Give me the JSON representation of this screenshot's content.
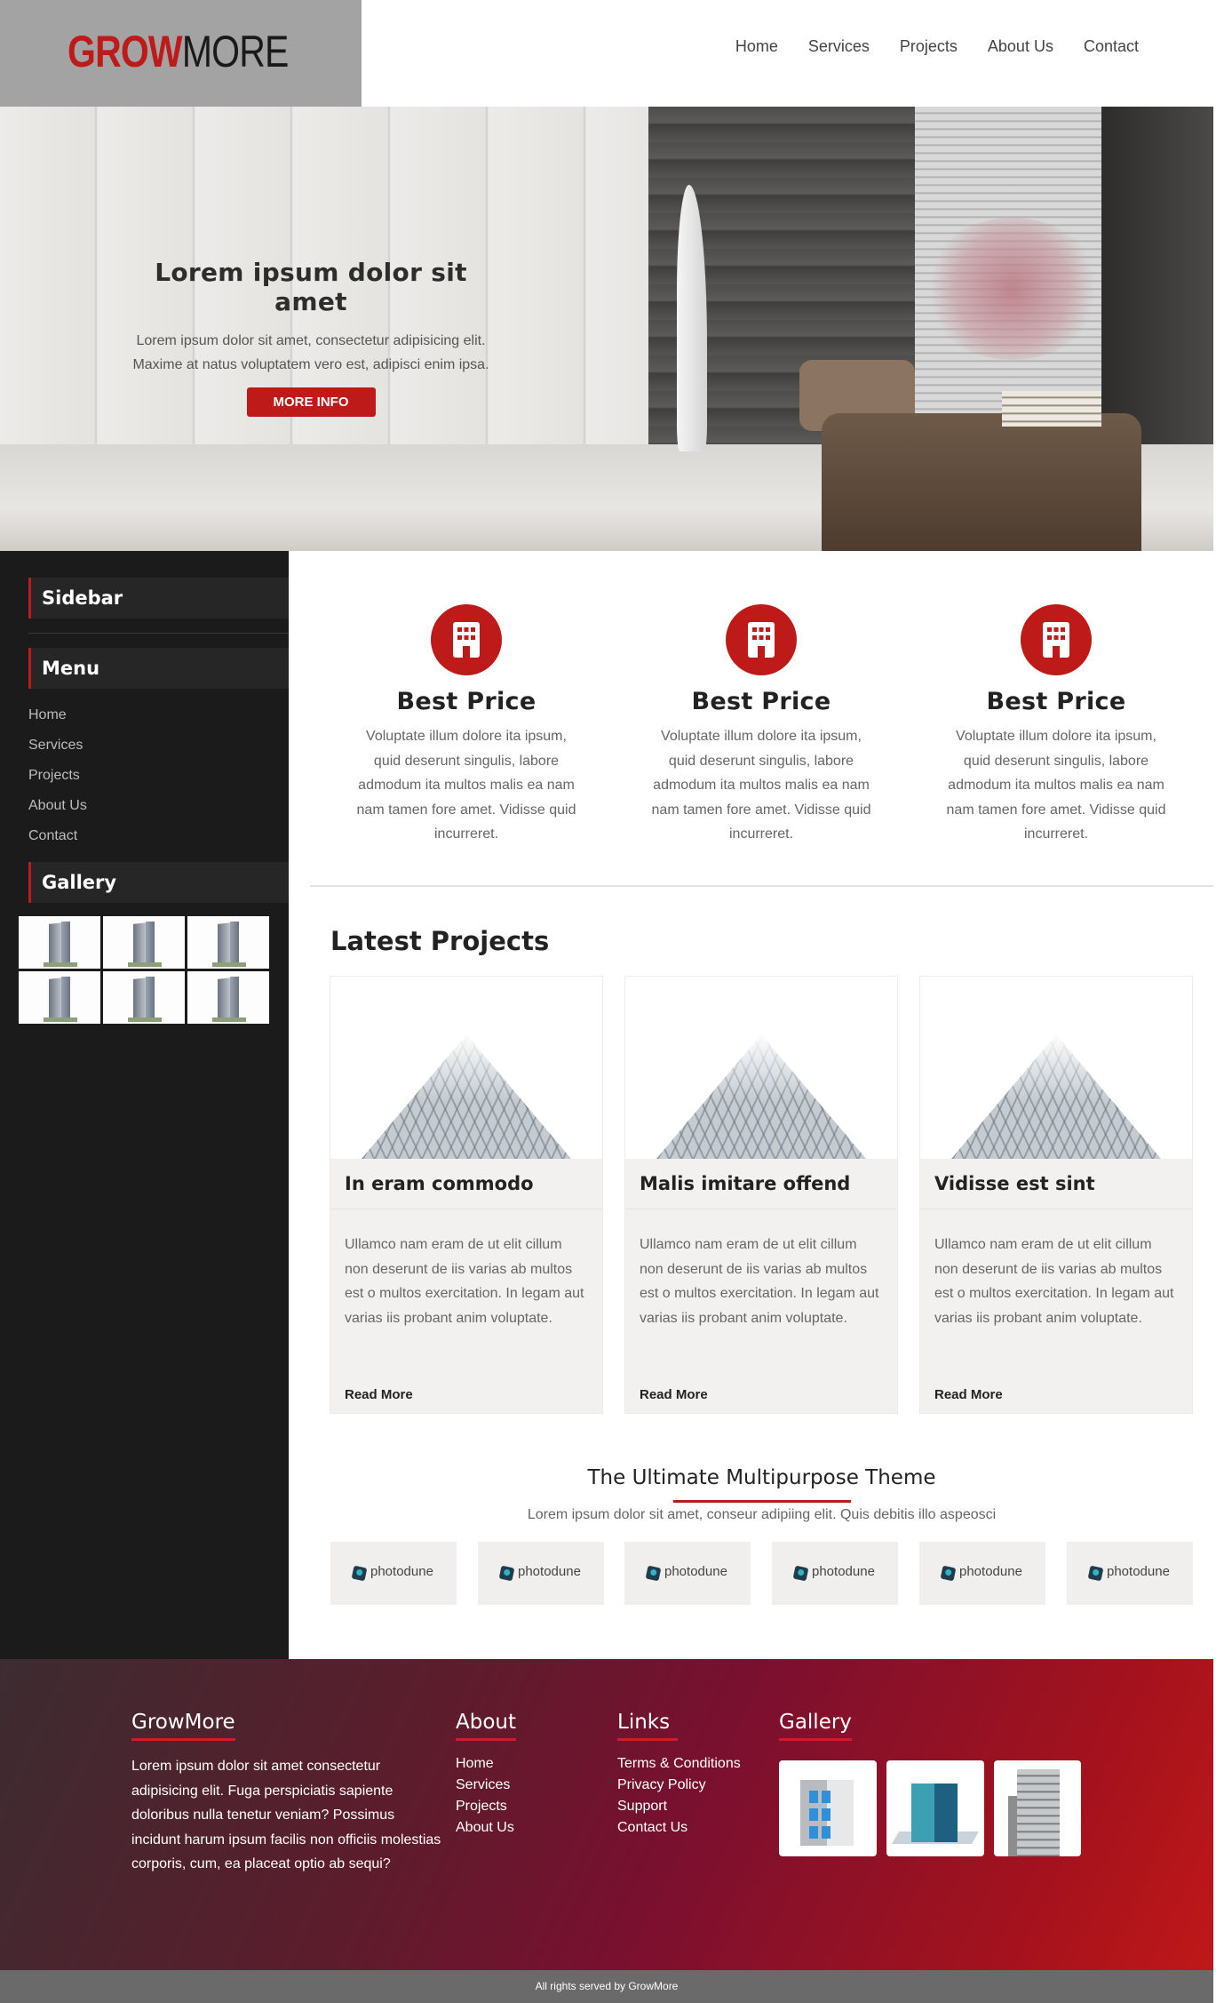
{
  "header": {
    "logo_part1": "GROW",
    "logo_part2": "MORE",
    "nav": [
      "Home",
      "Services",
      "Projects",
      "About Us",
      "Contact"
    ]
  },
  "hero": {
    "title": "Lorem ipsum dolor sit amet",
    "subtitle_line1": "Lorem ipsum dolor sit amet, consectetur adipisicing elit.",
    "subtitle_line2": "Maxime at natus voluptatem vero est, adipisci enim ipsa.",
    "button": "MORE INFO"
  },
  "sidebar": {
    "heading": "Sidebar",
    "menu_heading": "Menu",
    "menu": [
      "Home",
      "Services",
      "Projects",
      "About Us",
      "Contact"
    ],
    "gallery_heading": "Gallery"
  },
  "features": [
    {
      "title": "Best Price",
      "text": "Voluptate illum dolore ita ipsum, quid deserunt singulis, labore admodum ita multos malis ea nam nam tamen fore amet. Vidisse quid incurreret.",
      "icon": "building-icon"
    },
    {
      "title": "Best Price",
      "text": "Voluptate illum dolore ita ipsum, quid deserunt singulis, labore admodum ita multos malis ea nam nam tamen fore amet. Vidisse quid incurreret.",
      "icon": "building-icon"
    },
    {
      "title": "Best Price",
      "text": "Voluptate illum dolore ita ipsum, quid deserunt singulis, labore admodum ita multos malis ea nam nam tamen fore amet. Vidisse quid incurreret.",
      "icon": "building-icon"
    }
  ],
  "projects": {
    "title": "Latest Projects",
    "items": [
      {
        "title": "In eram commodo",
        "text": "Ullamco nam eram de ut elit cillum non deserunt de iis varias ab multos est o multos exercitation. In legam aut varias iis probant anim voluptate.",
        "link": "Read More"
      },
      {
        "title": "Malis imitare offend",
        "text": "Ullamco nam eram de ut elit cillum non deserunt de iis varias ab multos est o multos exercitation. In legam aut varias iis probant anim voluptate.",
        "link": "Read More"
      },
      {
        "title": "Vidisse est sint",
        "text": "Ullamco nam eram de ut elit cillum non deserunt de iis varias ab multos est o multos exercitation. In legam aut varias iis probant anim voluptate.",
        "link": "Read More"
      }
    ]
  },
  "theme": {
    "title": "The Ultimate Multipurpose Theme",
    "subtitle": "Lorem ipsum dolor sit amet, conseur adipiing elit. Quis debitis illo aspeosci",
    "partners": [
      "photodune",
      "photodune",
      "photodune",
      "photodune",
      "photodune",
      "photodune"
    ]
  },
  "footer": {
    "col1_head": "GrowMore",
    "col1_text": "Lorem ipsum dolor sit amet consectetur adipisicing elit. Fuga perspiciatis sapiente doloribus nulla tenetur veniam? Possimus incidunt harum ipsum facilis non officiis molestias corporis, cum, ea placeat optio ab sequi?",
    "col2_head": "About",
    "col2_items": [
      "Home",
      "Services",
      "Projects",
      "About Us"
    ],
    "col3_head": "Links",
    "col3_items": [
      "Terms & Conditions",
      "Privacy Policy",
      "Support",
      "Contact Us"
    ],
    "col4_head": "Gallery",
    "copyright": "All rights served by GrowMore"
  },
  "colors": {
    "accent": "#bf1a1a",
    "sidebar_bg": "#1b1b1b",
    "header_logo_bg": "#a3a3a3",
    "bottom_bar": "#6a6a6a"
  }
}
